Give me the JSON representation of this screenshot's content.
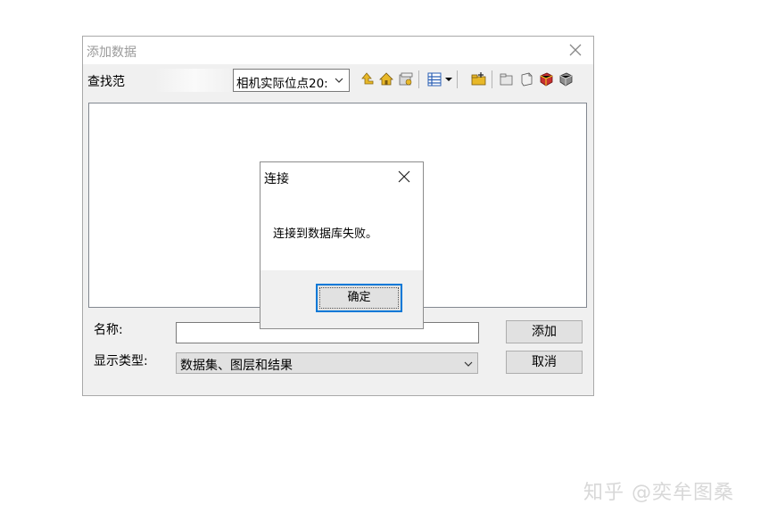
{
  "dialog": {
    "title": "添加数据",
    "look_in_label": "查找范",
    "location_value": "相机实际位点20:",
    "name_label": "名称:",
    "name_value": "",
    "type_label": "显示类型:",
    "type_value": "数据集、图层和结果",
    "add_button": "添加",
    "cancel_button": "取消"
  },
  "message_box": {
    "title": "连接",
    "message": "连接到数据库失败。",
    "ok_button": "确定"
  },
  "watermark": "知乎 @奕牟图桑",
  "colors": {
    "focus_border": "#0078d7",
    "folder_yellow": "#e8b828",
    "toolbar_blue": "#2b5fb4",
    "db_red": "#c83030"
  },
  "icons": [
    "up-folder-icon",
    "home-icon",
    "catalog-connect-icon",
    "view-menu-icon",
    "new-folder-icon",
    "new-file-gdb-icon",
    "new-shapefile-icon",
    "new-database-icon",
    "connect-database-icon"
  ]
}
